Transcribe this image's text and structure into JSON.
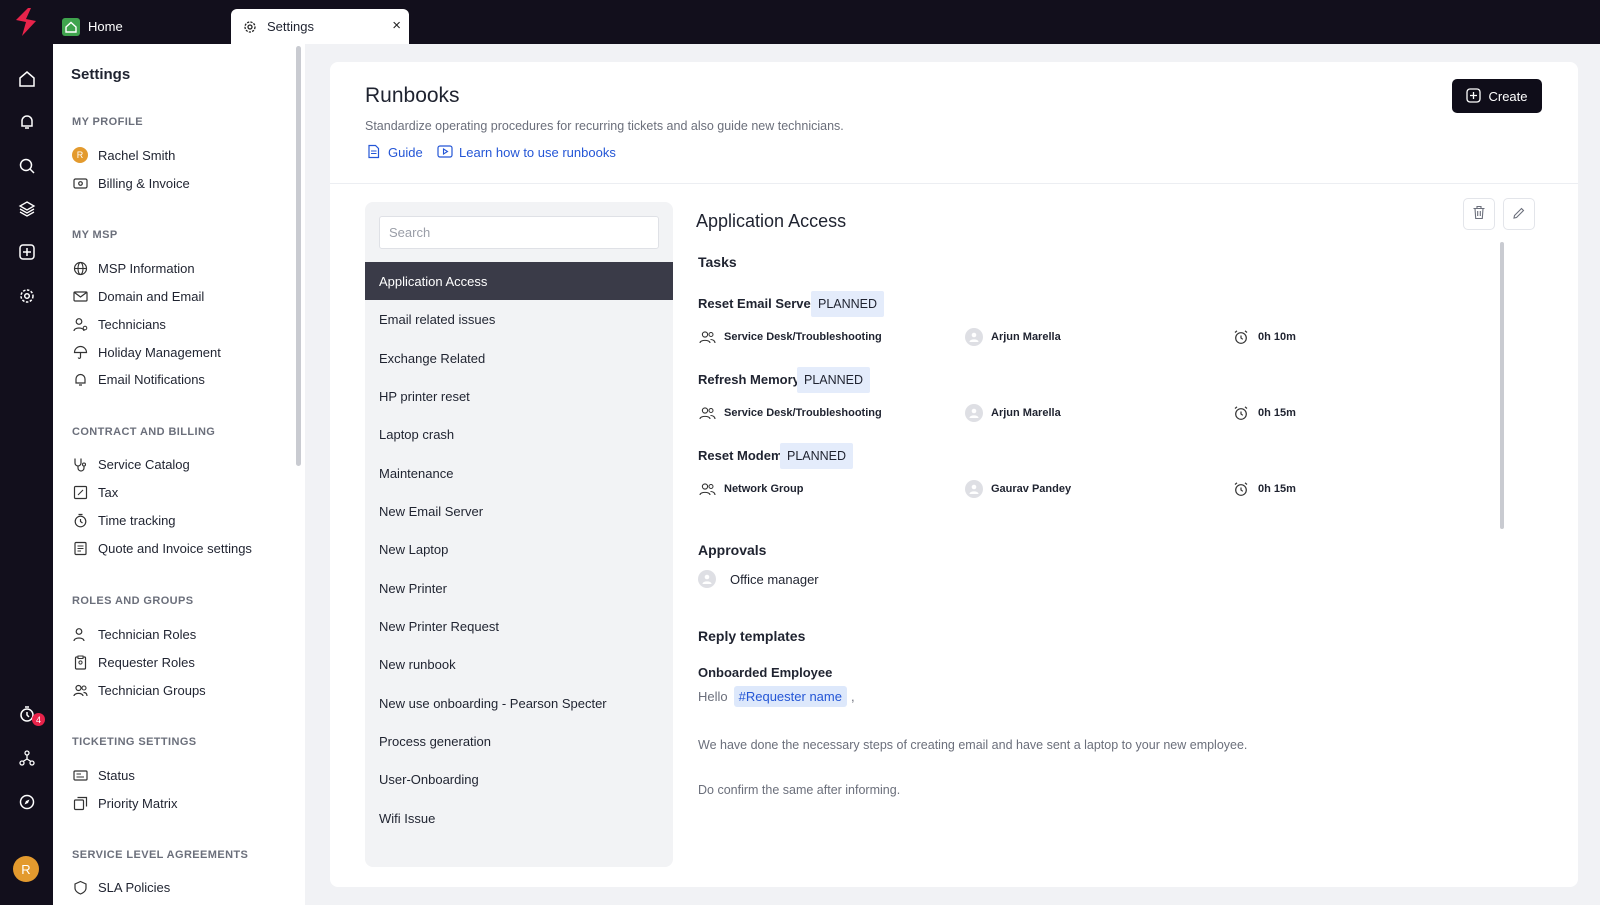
{
  "tabs": {
    "home": "Home",
    "settings": "Settings",
    "close": "×"
  },
  "rail": {
    "notification_count": "4",
    "avatar_initial": "R"
  },
  "sidebar": {
    "title": "Settings",
    "sections": {
      "my_profile": "MY PROFILE",
      "my_msp": "MY MSP",
      "contract": "CONTRACT AND BILLING",
      "roles": "ROLES AND GROUPS",
      "ticketing": "TICKETING SETTINGS",
      "sla": "SERVICE LEVEL AGREEMENTS"
    },
    "profile_avatar": "R",
    "items": {
      "rachel": "Rachel Smith",
      "billing": "Billing & Invoice",
      "msp_info": "MSP Information",
      "domain": "Domain and Email",
      "technicians": "Technicians",
      "holiday": "Holiday Management",
      "email_notif": "Email Notifications",
      "service_catalog": "Service Catalog",
      "tax": "Tax",
      "time_tracking": "Time tracking",
      "quote": "Quote and Invoice settings",
      "tech_roles": "Technician Roles",
      "req_roles": "Requester Roles",
      "tech_groups": "Technician Groups",
      "status": "Status",
      "priority": "Priority Matrix",
      "sla_policies": "SLA Policies"
    }
  },
  "page": {
    "title": "Runbooks",
    "description": "Standardize operating procedures for recurring tickets and also guide new technicians.",
    "guide_link": "Guide",
    "learn_link": "Learn how to use runbooks",
    "create_label": "Create"
  },
  "list": {
    "search_placeholder": "Search",
    "items": [
      "Application Access",
      "Email related issues",
      "Exchange Related",
      "HP printer reset",
      "Laptop crash",
      "Maintenance",
      "New Email Server",
      "New Laptop",
      "New Printer",
      "New Printer Request",
      "New runbook",
      "New use onboarding - Pearson Specter",
      "Process generation",
      "User-Onboarding",
      "Wifi Issue"
    ]
  },
  "detail": {
    "title": "Application Access",
    "tasks_heading": "Tasks",
    "tasks": [
      {
        "name": "Reset Email Server",
        "status": "PLANNED",
        "group": "Service Desk/Troubleshooting",
        "assignee": "Arjun Marella",
        "duration": "0h 10m"
      },
      {
        "name": "Refresh Memory",
        "status": "PLANNED",
        "group": "Service Desk/Troubleshooting",
        "assignee": "Arjun Marella",
        "duration": "0h 15m"
      },
      {
        "name": "Reset Modem",
        "status": "PLANNED",
        "group": "Network Group",
        "assignee": "Gaurav Pandey",
        "duration": "0h 15m"
      }
    ],
    "approvals_heading": "Approvals",
    "approver": "Office manager",
    "reply_heading": "Reply templates",
    "template_name": "Onboarded Employee",
    "hello": "Hello",
    "requester_chip": "#Requester name",
    "comma": ",",
    "para1": "We have done the necessary steps of creating email and have sent a laptop to your new employee.",
    "para2": "Do confirm the same after informing."
  },
  "colors": {
    "dark": "#120f1c",
    "active_item": "#3a3b48",
    "link": "#2456d6",
    "badge": "#e8234a",
    "planned_bg": "#e4ecfb"
  }
}
